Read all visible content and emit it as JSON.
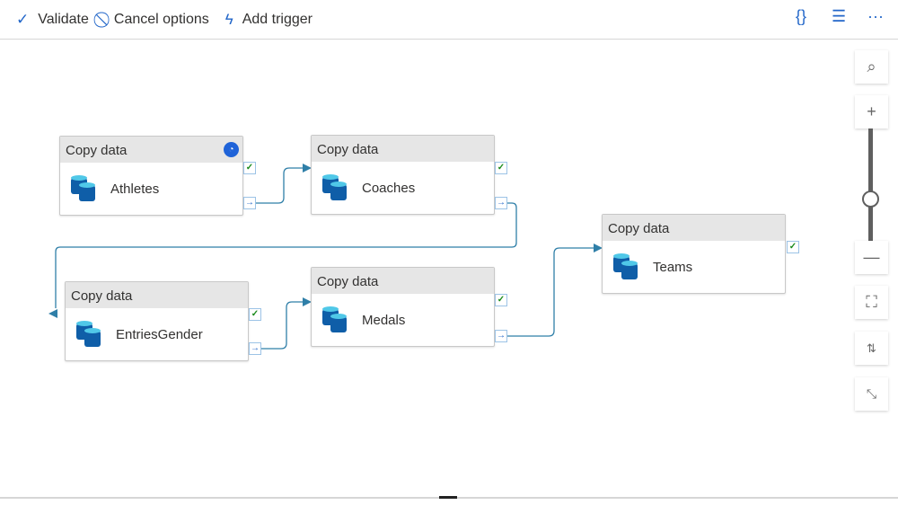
{
  "toolbar": {
    "validate": "Validate",
    "cancel": "Cancel options",
    "add_trigger": "Add trigger"
  },
  "nodes": [
    {
      "type": "Copy data",
      "name": "Athletes"
    },
    {
      "type": "Copy data",
      "name": "Coaches"
    },
    {
      "type": "Copy data",
      "name": "EntriesGender"
    },
    {
      "type": "Copy data",
      "name": "Medals"
    },
    {
      "type": "Copy data",
      "name": "Teams"
    }
  ],
  "zoom": {
    "slider_fraction": 0.37
  },
  "colors": {
    "accent": "#2266c9",
    "connector": "#2f7fa8",
    "success": "#1a8a1a"
  }
}
